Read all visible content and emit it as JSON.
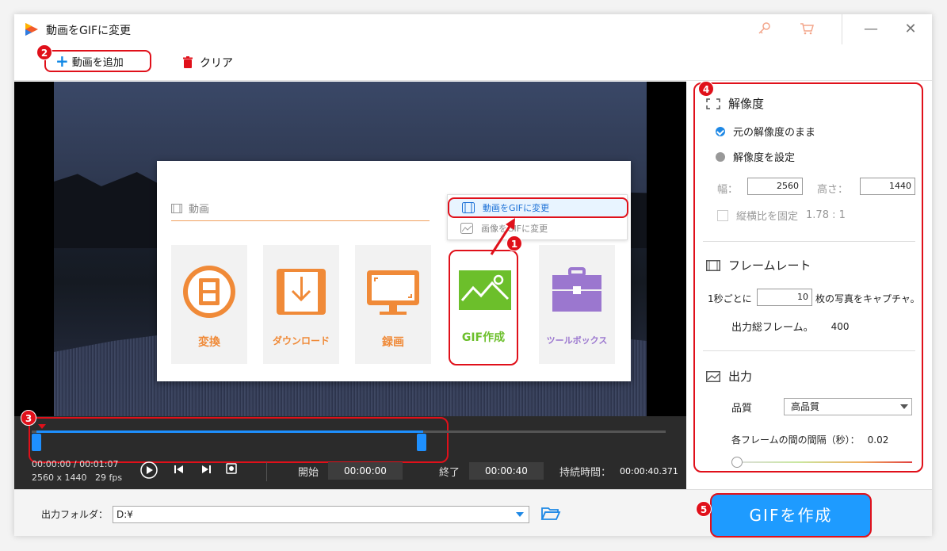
{
  "window": {
    "title": "動画をGIFに変更"
  },
  "toolbar": {
    "add_label": "動画を追加",
    "clear_label": "クリア"
  },
  "badges": [
    "1",
    "2",
    "3",
    "4",
    "5"
  ],
  "menu": {
    "section_label": "動画",
    "tiles": [
      {
        "label": "変換",
        "icon": "film-convert-icon"
      },
      {
        "label": "ダウンロード",
        "icon": "download-icon"
      },
      {
        "label": "録画",
        "icon": "screen-record-icon"
      },
      {
        "label": "GIF作成",
        "icon": "gif-image-icon"
      },
      {
        "label": "ツールボックス",
        "icon": "toolbox-icon"
      }
    ],
    "popup": [
      {
        "label": "動画をGIFに変更",
        "active": true
      },
      {
        "label": "画像をGIFに変更",
        "active": false
      }
    ]
  },
  "timeline": {
    "current": "00:00:00",
    "total": "/ 00:01:07",
    "resolution": "2560 x 1440",
    "fps": "29 fps",
    "start_label": "開始",
    "start_value": "00:00:00",
    "end_label": "終了",
    "end_value": "00:00:40",
    "duration_label": "持続時間：",
    "duration_value": "00:00:40.371"
  },
  "resolution": {
    "title": "解像度",
    "keep_label": "元の解像度のまま",
    "set_label": "解像度を設定",
    "width_label": "幅：",
    "width_value": "2560",
    "height_label": "高さ：",
    "height_value": "1440",
    "ratio_label": "縦横比を固定",
    "ratio_value": "1.78 : 1"
  },
  "framerate": {
    "title": "フレームレート",
    "per_sec_label": "1秒ごとに",
    "per_sec_value": "10",
    "capture_label": "枚の写真をキャプチャ。",
    "total_label": "出力総フレーム。",
    "total_value": "400"
  },
  "output": {
    "title": "出力",
    "quality_label": "品質",
    "quality_value": "高品質",
    "interval_label": "各フレームの間の間隔（秒）：",
    "interval_value": "0.02",
    "interval_level": 0.0
  },
  "bottom": {
    "folder_label": "出力フォルダ：",
    "folder_value": "D:¥",
    "create_label": "GIFを作成"
  },
  "colors": {
    "accent": "#1e9bff",
    "highlight": "#e0101a",
    "orange": "#f08a38",
    "green": "#6cbf2b",
    "purple": "#9b77cf"
  }
}
